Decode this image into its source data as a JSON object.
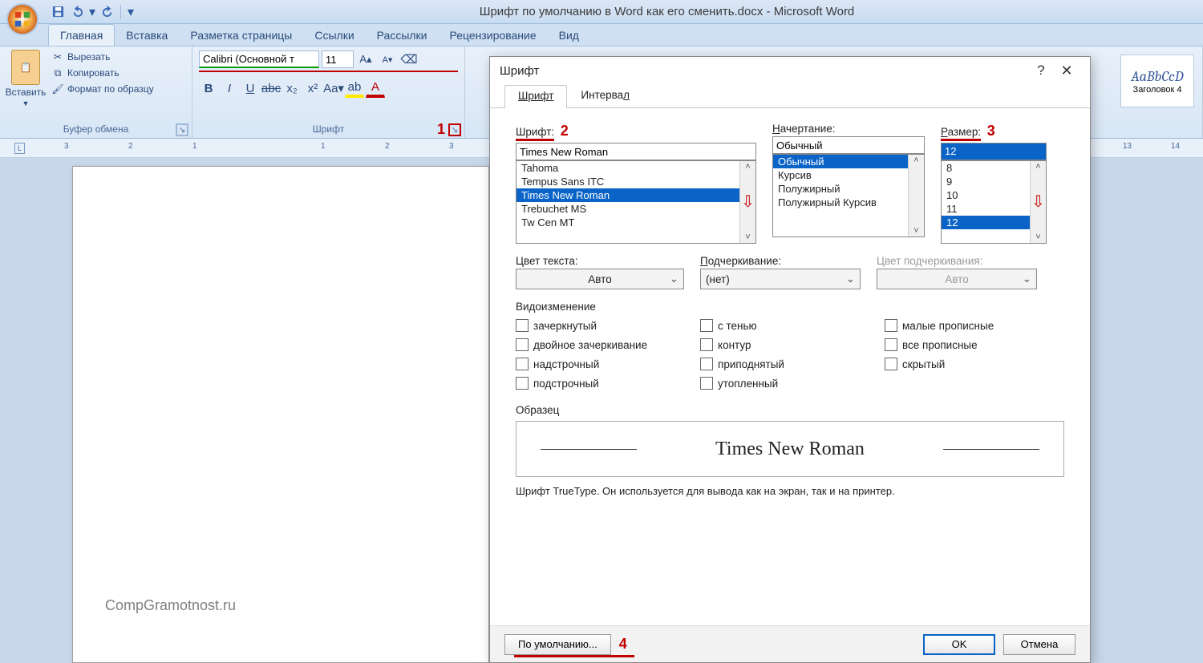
{
  "title": "Шрифт по умолчанию в Word как его сменить.docx - Microsoft Word",
  "ribbon_tabs": [
    "Главная",
    "Вставка",
    "Разметка страницы",
    "Ссылки",
    "Рассылки",
    "Рецензирование",
    "Вид"
  ],
  "clipboard": {
    "paste": "Вставить",
    "cut": "Вырезать",
    "copy": "Копировать",
    "format_painter": "Формат по образцу",
    "group": "Буфер обмена"
  },
  "font_group": {
    "name": "Calibri (Основной т",
    "size": "11",
    "group": "Шрифт"
  },
  "annotation": {
    "n1": "1",
    "n2": "2",
    "n3": "3",
    "n4": "4"
  },
  "style_tile": {
    "preview": "AaBbCcD",
    "label": "Заголовок 4"
  },
  "ruler_left": [
    "3",
    "2",
    "1"
  ],
  "ruler_right": [
    "1",
    "2",
    "3",
    "13",
    "14"
  ],
  "watermark": "CompGramotnost.ru",
  "dialog": {
    "title": "Шрифт",
    "tabs": {
      "font": "Шрифт",
      "spacing": "Интервал"
    },
    "font_label": "Шрифт:",
    "font_value": "Times New Roman",
    "font_list": [
      "Tahoma",
      "Tempus Sans ITC",
      "Times New Roman",
      "Trebuchet MS",
      "Tw Cen MT"
    ],
    "style_label": "Начертание:",
    "style_value": "Обычный",
    "style_list": [
      "Обычный",
      "Курсив",
      "Полужирный",
      "Полужирный Курсив"
    ],
    "size_label": "Размер:",
    "size_value": "12",
    "size_list": [
      "8",
      "9",
      "10",
      "11",
      "12"
    ],
    "color_label": "Цвет текста:",
    "color_value": "Авто",
    "underline_label": "Подчеркивание:",
    "underline_value": "(нет)",
    "ucolor_label": "Цвет подчеркивания:",
    "ucolor_value": "Авто",
    "effects_label": "Видоизменение",
    "fx": {
      "strike": "зачеркнутый",
      "dstrike": "двойное зачеркивание",
      "super": "надстрочный",
      "sub": "подстрочный",
      "shadow": "с тенью",
      "outline": "контур",
      "emboss": "приподнятый",
      "engrave": "утопленный",
      "smallcaps": "малые прописные",
      "allcaps": "все прописные",
      "hidden": "скрытый"
    },
    "preview_label": "Образец",
    "preview_text": "Times New Roman",
    "hint": "Шрифт TrueType. Он используется для вывода как на экран, так и на принтер.",
    "btn_default": "По умолчанию...",
    "btn_ok": "OK",
    "btn_cancel": "Отмена"
  }
}
